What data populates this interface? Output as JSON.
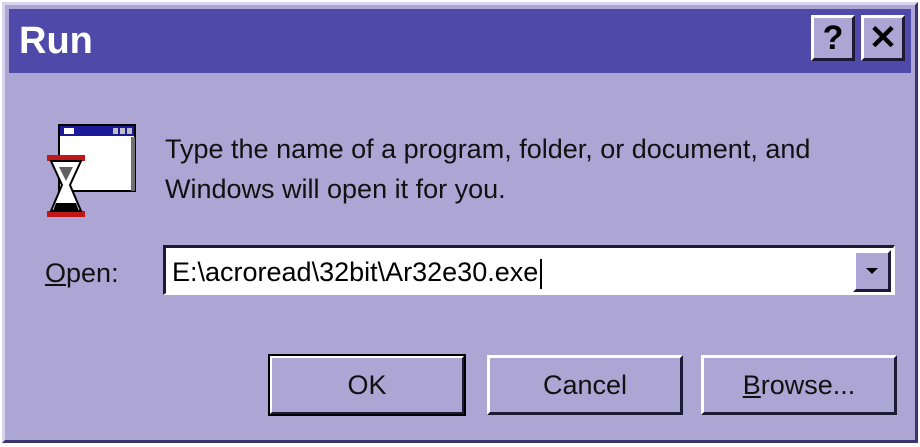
{
  "window": {
    "title": "Run",
    "help_label": "?",
    "close_label": "✕"
  },
  "message": {
    "line1": "Type the name of a program, folder, or document, and",
    "line2": "Windows will open it for you."
  },
  "open_field": {
    "label_mnemonic": "O",
    "label_rest": "pen:",
    "value": "E:\\acroread\\32bit\\Ar32e30.exe"
  },
  "buttons": {
    "ok": "OK",
    "cancel": "Cancel",
    "browse_mnemonic": "B",
    "browse_rest": "rowse..."
  },
  "colors": {
    "title_bar": "#4f4aa9",
    "face": "#ada6d4"
  }
}
